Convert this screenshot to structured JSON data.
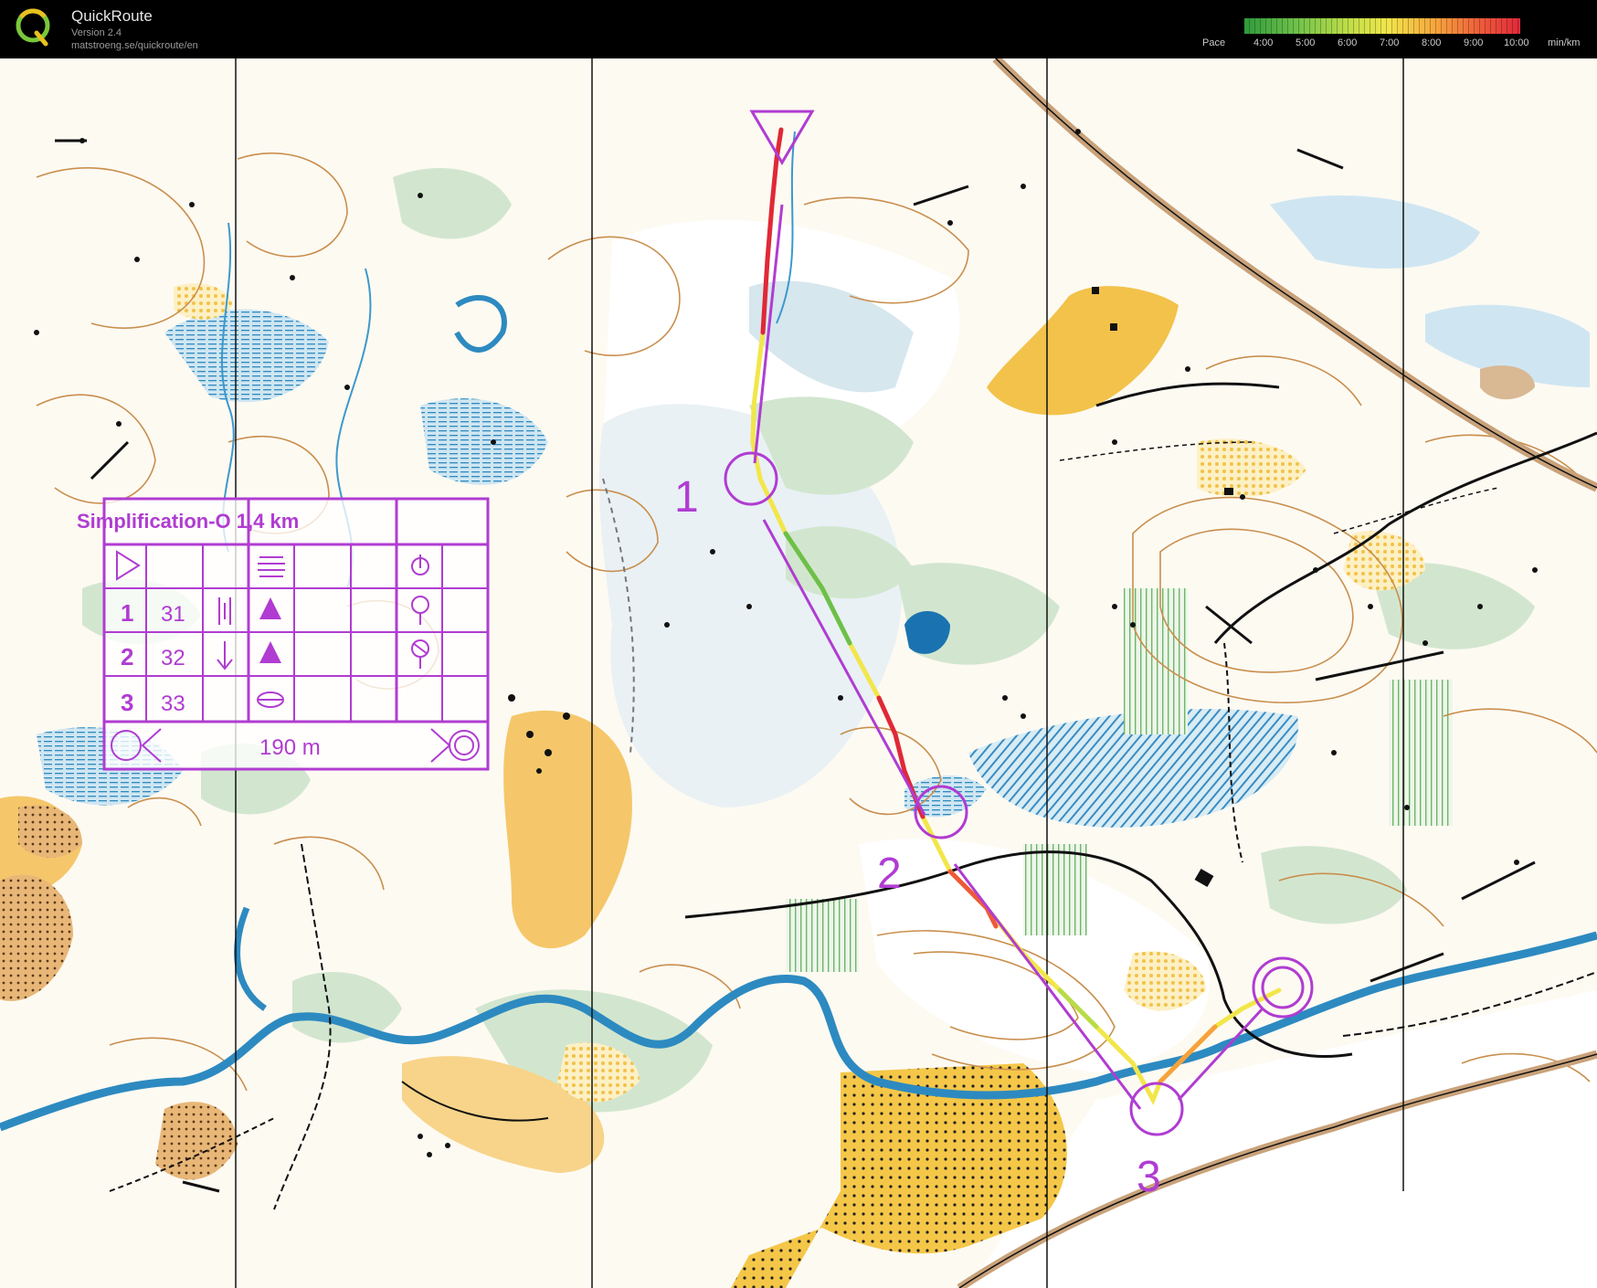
{
  "app": {
    "name": "QuickRoute",
    "version": "Version 2.4",
    "url": "matstroeng.se/quickroute/en",
    "logo_letter": "Q"
  },
  "pace_legend": {
    "label": "Pace",
    "ticks": [
      "4:00",
      "5:00",
      "6:00",
      "7:00",
      "8:00",
      "9:00",
      "10:00"
    ],
    "unit": "min/km",
    "gradient_colors": [
      "#2e9a3a",
      "#6cc04a",
      "#b8dc48",
      "#f2e64a",
      "#f6a23c",
      "#ee5a3a",
      "#e0283a"
    ]
  },
  "course": {
    "title": "Simplification-O 1,4 km",
    "finish_distance": "190 m",
    "controls": [
      {
        "number": "1",
        "code": "31",
        "label": "1"
      },
      {
        "number": "2",
        "code": "32",
        "label": "2"
      },
      {
        "number": "3",
        "code": "33",
        "label": "3"
      }
    ],
    "course_color": "#b03cd2"
  },
  "map_colors": {
    "background": "#ffffff",
    "open_yellow": "#f5c748",
    "light_yellow": "#fbe6a6",
    "water_blue": "#5aa8d6",
    "marsh_blue": "#cfe6f2",
    "vegetation_green": "#cfe4cc",
    "contour_brown": "#c98f4e",
    "black": "#111111"
  }
}
